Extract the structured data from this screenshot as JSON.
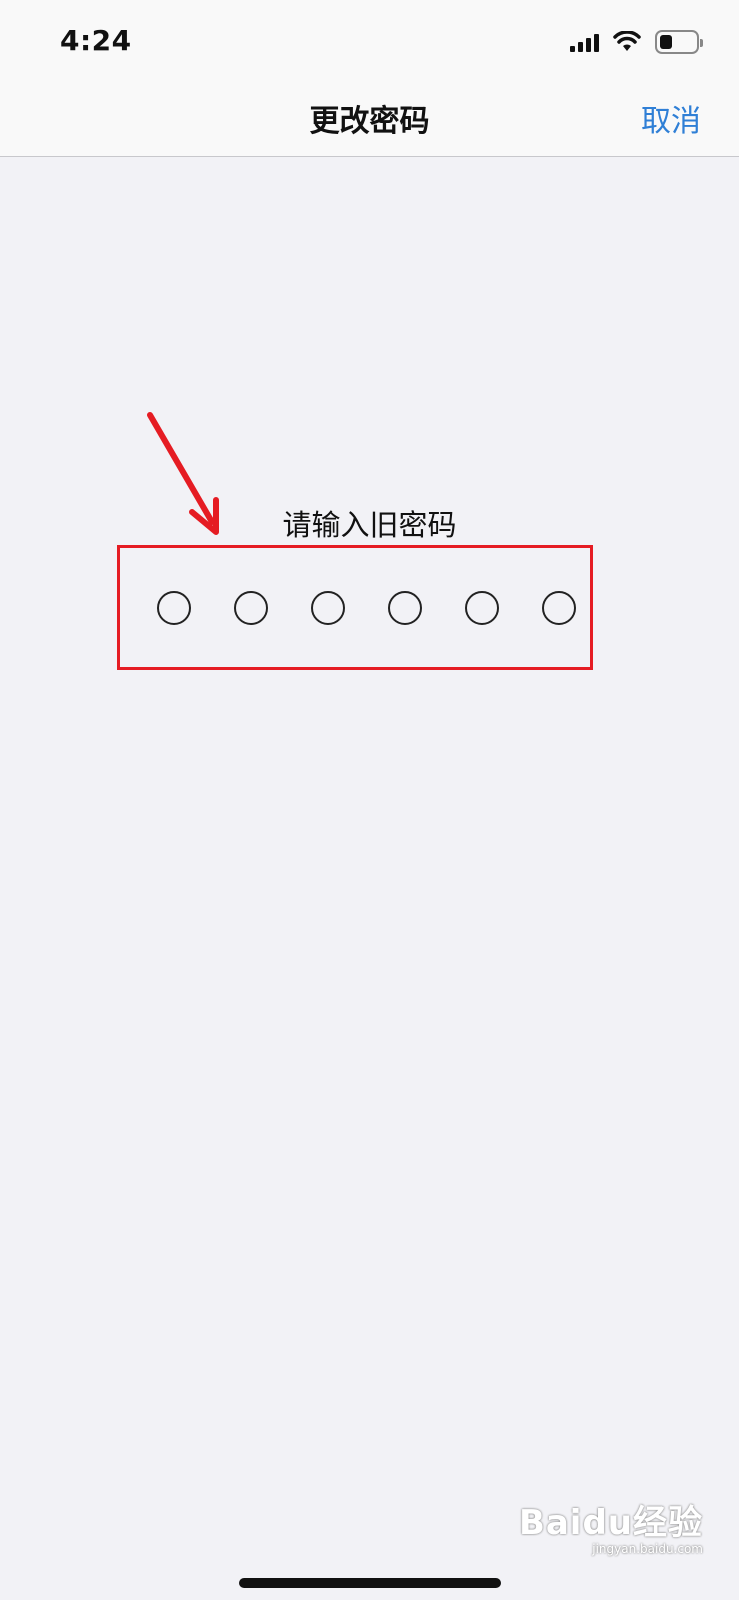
{
  "status_bar": {
    "time": "4:24",
    "signal_icon": "cellular-signal-icon",
    "wifi_icon": "wifi-icon",
    "battery_icon": "battery-icon",
    "battery_level": 0.35
  },
  "nav": {
    "title": "更改密码",
    "cancel_label": "取消",
    "accent_color": "#2f7fd6"
  },
  "passcode": {
    "prompt": "请输入旧密码",
    "digits_total": 6,
    "digits_entered": 0
  },
  "annotation": {
    "highlight_color": "#e51c23",
    "arrow_icon": "red-arrow-icon"
  },
  "watermark": {
    "main": "Baidu经验",
    "sub": "jingyan.baidu.com"
  }
}
